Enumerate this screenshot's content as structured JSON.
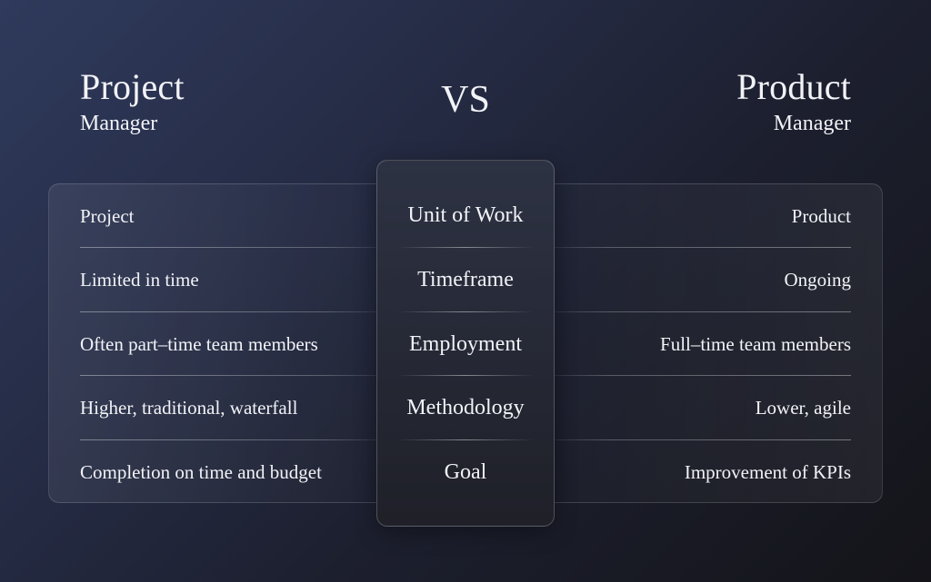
{
  "header": {
    "left": {
      "title": "Project",
      "subtitle": "Manager"
    },
    "vs": "VS",
    "right": {
      "title": "Product",
      "subtitle": "Manager"
    }
  },
  "criteria": [
    "Unit of Work",
    "Timeframe",
    "Employment",
    "Methodology",
    "Goal"
  ],
  "project_manager": [
    "Project",
    "Limited in time",
    "Often part–time team members",
    "Higher, traditional, waterfall",
    "Completion on time and budget"
  ],
  "product_manager": [
    "Product",
    "Ongoing",
    "Full–time team members",
    "Lower, agile",
    "Improvement of KPIs"
  ],
  "colors": {
    "text": "#f2f3f7",
    "background_start": "#2f3a5c",
    "background_end": "#141419"
  }
}
